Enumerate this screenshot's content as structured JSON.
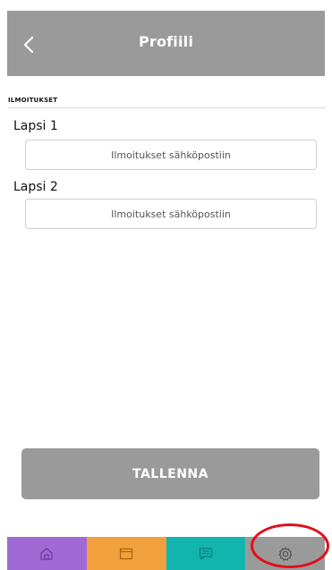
{
  "header": {
    "title": "Profiili",
    "back_icon": "chevron-left-icon",
    "background": "#9a9a9a"
  },
  "section": {
    "title": "ILMOITUKSET"
  },
  "children": [
    {
      "label": "Lapsi 1",
      "button_label": "Ilmoitukset sähköpostiin"
    },
    {
      "label": "Lapsi 2",
      "button_label": "Ilmoitukset sähköpostiin"
    }
  ],
  "save_button": {
    "label": "TALLENNA"
  },
  "tabbar": {
    "tabs": [
      {
        "name": "home",
        "icon": "home-icon",
        "color": "#a06ad6"
      },
      {
        "name": "calendar",
        "icon": "calendar-icon",
        "color": "#f0a03c"
      },
      {
        "name": "messages",
        "icon": "message-icon",
        "color": "#12b5ad"
      },
      {
        "name": "settings",
        "icon": "gear-icon",
        "color": "#9a9a9a"
      }
    ]
  },
  "annotation": {
    "highlight_color": "#e0101a"
  }
}
